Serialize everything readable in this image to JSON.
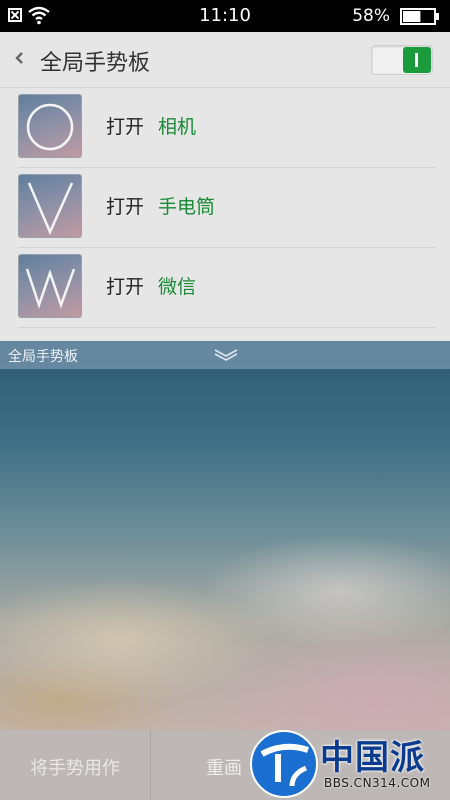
{
  "status_bar": {
    "time": "11:10",
    "battery_text": "58%",
    "battery_level": 0.58,
    "icons": [
      "no-sim-icon",
      "wifi-icon",
      "battery-icon"
    ]
  },
  "header": {
    "title": "全局手势板",
    "toggle_on": true,
    "accent_color": "#1c9b3c"
  },
  "gestures": [
    {
      "shape": "O",
      "action": "打开",
      "app": "相机"
    },
    {
      "shape": "V",
      "action": "打开",
      "app": "手电筒"
    },
    {
      "shape": "W",
      "action": "打开",
      "app": "微信"
    }
  ],
  "gesture_panel": {
    "label": "全局手势板",
    "icon": "chevron-down-double-icon"
  },
  "bottom_bar": {
    "use_gesture": "将手势用作",
    "redraw": "重画"
  },
  "watermark": {
    "brand": "中国派",
    "site": "BBS.CN314.COM"
  }
}
